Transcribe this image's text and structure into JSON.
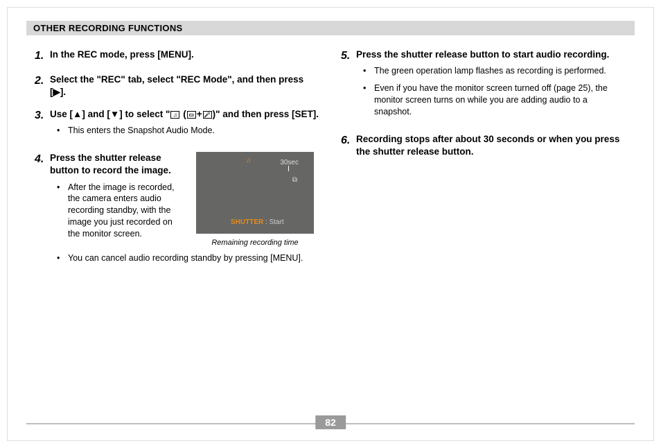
{
  "header": {
    "title": "OTHER RECORDING FUNCTIONS"
  },
  "steps": {
    "s1": {
      "num": "1.",
      "head": "In the REC mode, press [MENU]."
    },
    "s2": {
      "num": "2.",
      "head_a": "Select the \"REC\" tab, select \"REC Mode\", and then press [",
      "head_b": "]."
    },
    "s3": {
      "num": "3.",
      "head_a": "Use [",
      "head_b": "] and [",
      "head_c": "] to select  \"",
      "head_d": " (",
      "head_e": "+",
      "head_f": ")\" and then press [SET].",
      "bullet1": "This enters the Snapshot Audio Mode."
    },
    "s4": {
      "num": "4.",
      "head": "Press the shutter release button to record the image.",
      "bullet1": "After the image is recorded, the camera enters audio recording standby, with the image you just recorded on the monitor screen.",
      "bullet2": "You can cancel audio recording standby by pressing [MENU]."
    },
    "s5": {
      "num": "5.",
      "head": "Press the shutter release button to start audio recording.",
      "bullet1": "The green operation lamp flashes as recording is performed.",
      "bullet2": "Even if you have the monitor screen turned off (page 25), the monitor screen turns on while you are adding audio to a snapshot."
    },
    "s6": {
      "num": "6.",
      "head": "Recording stops after about 30 seconds or when you press the shutter release button."
    }
  },
  "figure": {
    "mode_icon": "♫",
    "time": "30sec",
    "sd": "⧉",
    "shutter_label": "SHUTTER",
    "start_label": " : Start",
    "caption": "Remaining recording time"
  },
  "page_number": "82",
  "glyphs": {
    "right": "▶",
    "up": "▲",
    "down": "▼",
    "snap_audio": "♫",
    "snap": "▭",
    "mic": "🎤"
  }
}
